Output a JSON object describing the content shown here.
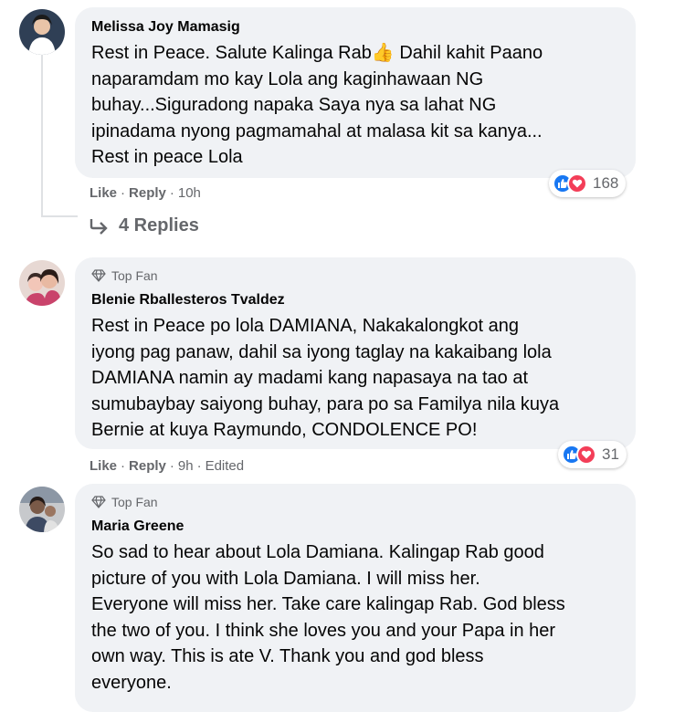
{
  "colors": {
    "bubble_bg": "#f0f2f5",
    "meta_text": "#65676b",
    "like_blue": "#1877f2",
    "love_red": "#f33e58"
  },
  "comments": [
    {
      "author": "Melissa Joy Mamasig",
      "badge": "",
      "text_lines": [
        "Rest in Peace. Salute Kalinga Rab👍  Dahil kahit Paano",
        "naparamdam mo kay Lola ang kaginhawaan NG",
        "buhay...Siguradong napaka Saya nya sa lahat NG",
        "ipinadama nyong pagmamahal at malasa kit sa kanya...",
        "Rest in peace Lola"
      ],
      "reaction_count": "168",
      "actions": {
        "like": "Like",
        "reply": "Reply",
        "time": "10h",
        "edited": ""
      }
    },
    {
      "author": "Blenie Rballesteros Tvaldez",
      "badge": "Top Fan",
      "text_lines": [
        "Rest in Peace po lola DAMIANA, Nakakalongkot ang",
        "iyong pag panaw, dahil sa iyong taglay na kakaibang lola",
        "DAMIANA namin ay madami kang napasaya na tao at",
        "sumubaybay saiyong buhay, para po sa Familya nila kuya",
        "Bernie at kuya Raymundo, CONDOLENCE PO!"
      ],
      "reaction_count": "31",
      "actions": {
        "like": "Like",
        "reply": "Reply",
        "time": "9h",
        "edited": "Edited"
      }
    },
    {
      "author": "Maria Greene",
      "badge": "Top Fan",
      "text_lines": [
        "So sad to hear about Lola Damiana. Kalingap Rab good",
        "picture of you with Lola Damiana. I will miss her.",
        "Everyone will miss her. Take care kalingap Rab. God bless",
        "the two of you. I think she loves you and your Papa in her",
        "own way. This is ate V. Thank you and god bless",
        "everyone."
      ]
    }
  ],
  "replies_link": "4 Replies",
  "separator": "·",
  "icons": {
    "badge": "diamond-icon",
    "reply_arrow": "reply-arrow-icon",
    "like": "like-reaction-icon",
    "love": "love-reaction-icon"
  }
}
